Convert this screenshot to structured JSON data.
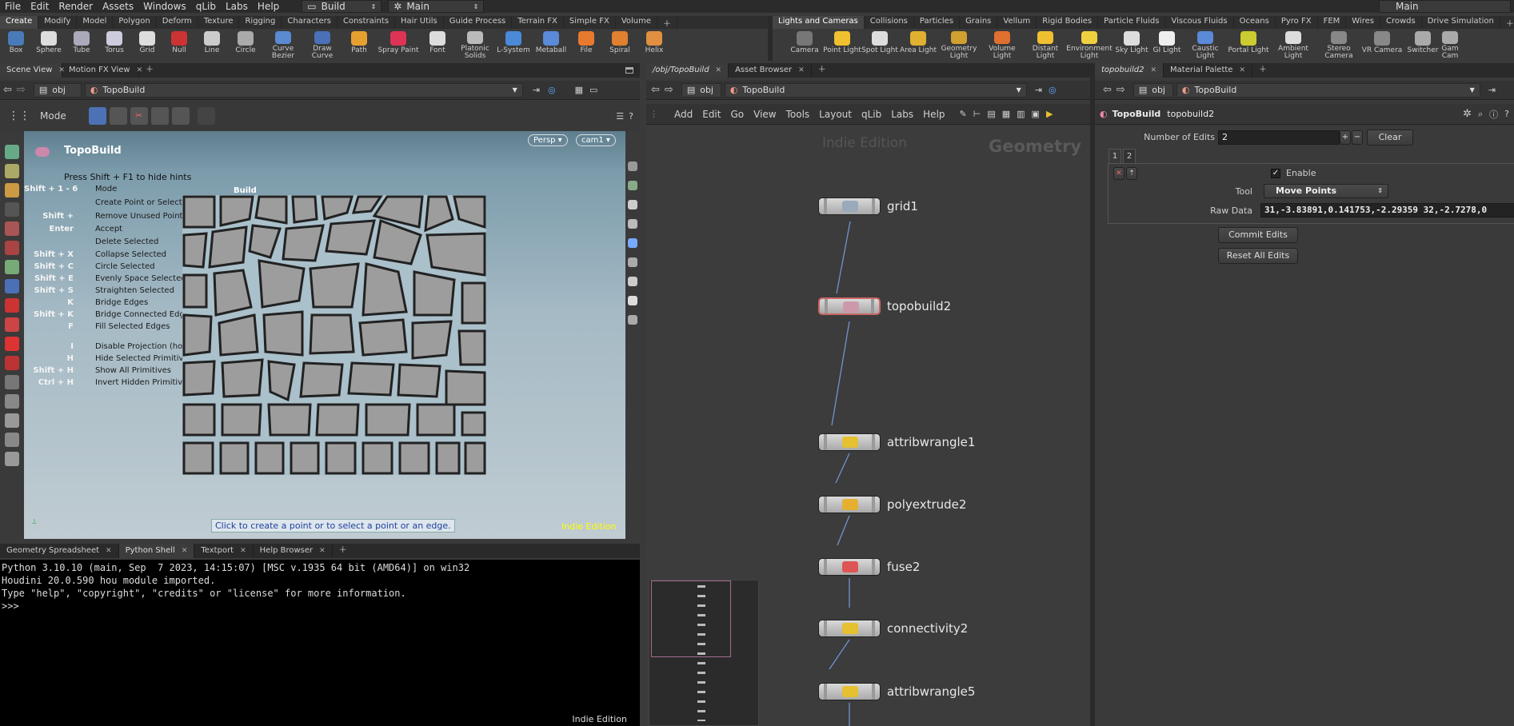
{
  "menubar": {
    "items": [
      "File",
      "Edit",
      "Render",
      "Assets",
      "Windows",
      "qLib",
      "Labs",
      "Help"
    ],
    "desktop": "Build",
    "context": "Main",
    "context_right": "Main"
  },
  "shelf_left": {
    "tabs": [
      "Create",
      "Modify",
      "Model",
      "Polygon",
      "Deform",
      "Texture",
      "Rigging",
      "Characters",
      "Constraints",
      "Hair Utils",
      "Guide Process",
      "Terrain FX",
      "Simple FX",
      "Volume"
    ],
    "tools": [
      "Box",
      "Sphere",
      "Tube",
      "Torus",
      "Grid",
      "Null",
      "Line",
      "Circle",
      "Curve Bezier",
      "Draw Curve",
      "Path",
      "Spray Paint",
      "Font",
      "Platonic Solids",
      "L-System",
      "Metaball",
      "File",
      "Spiral",
      "Helix"
    ],
    "colors": {
      "Box": "#4a7ab8",
      "Sphere": "#ddd",
      "Tube": "#aab",
      "Torus": "#ccd",
      "Grid": "#ddd",
      "Null": "#c33",
      "Line": "#ccc",
      "Circle": "#aaa",
      "Curve Bezier": "#5a8ad0",
      "Draw Curve": "#4a70b8",
      "Path": "#e6a030",
      "Spray Paint": "#d35",
      "Font": "#ddd",
      "Platonic Solids": "#bbb",
      "L-System": "#4a8ad8",
      "Metaball": "#5a8ad8",
      "File": "#e87a30",
      "Spiral": "#e08030",
      "Helix": "#e09040"
    }
  },
  "shelf_right": {
    "tabs": [
      "Lights and Cameras",
      "Collisions",
      "Particles",
      "Grains",
      "Vellum",
      "Rigid Bodies",
      "Particle Fluids",
      "Viscous Fluids",
      "Oceans",
      "Pyro FX",
      "FEM",
      "Wires",
      "Crowds",
      "Drive Simulation"
    ],
    "tools": [
      "Camera",
      "Point Light",
      "Spot Light",
      "Area Light",
      "Geometry Light",
      "Volume Light",
      "Distant Light",
      "Environment Light",
      "Sky Light",
      "GI Light",
      "Caustic Light",
      "Portal Light",
      "Ambient Light",
      "Stereo Camera",
      "VR Camera",
      "Switcher",
      "Gam Cam"
    ],
    "colors": {
      "Camera": "#777",
      "Point Light": "#f0c030",
      "Spot Light": "#ddd",
      "Area Light": "#e0b030",
      "Geometry Light": "#d0a030",
      "Volume Light": "#e07030",
      "Distant Light": "#f0c030",
      "Environment Light": "#f0d040",
      "Sky Light": "#ddd",
      "GI Light": "#eee",
      "Caustic Light": "#5a8ad8",
      "Portal Light": "#cccc30",
      "Ambient Light": "#ddd",
      "Stereo Camera": "#888",
      "VR Camera": "#888",
      "Switcher": "#aaa",
      "Gam Cam": "#aaa"
    }
  },
  "scene_view": {
    "tabs": [
      "Scene View",
      "Motion FX View"
    ],
    "path_root": "obj",
    "path_node": "TopoBuild",
    "mode_label": "Mode",
    "title": "TopoBuild",
    "persp": "Persp",
    "cam": "cam1",
    "hide_hint": "Press Shift + F1 to hide hints",
    "build_label": "Build",
    "hints": [
      {
        "key": "Shift + 1 - 6",
        "text": "Mode"
      },
      {
        "key": "",
        "text": "Create Point or Select Point or Edge"
      },
      {
        "key": "Shift +",
        "text": "Remove Unused Points"
      },
      {
        "key": "Enter",
        "text": "Accept"
      },
      {
        "key": "",
        "text": "Delete Selected"
      },
      {
        "key": "Shift + X",
        "text": "Collapse Selected"
      },
      {
        "key": "Shift + C",
        "text": "Circle Selected"
      },
      {
        "key": "Shift + E",
        "text": "Evenly Space Selected"
      },
      {
        "key": "Shift + S",
        "text": "Straighten Selected"
      },
      {
        "key": "K",
        "text": "Bridge Edges"
      },
      {
        "key": "Shift + K",
        "text": "Bridge Connected Edges"
      },
      {
        "key": "F",
        "text": "Fill Selected Edges"
      },
      {
        "key": "I",
        "text": "Disable Projection (hold)"
      },
      {
        "key": "H",
        "text": "Hide Selected Primitives"
      },
      {
        "key": "Shift + H",
        "text": "Show All Primitives"
      },
      {
        "key": "Ctrl + H",
        "text": "Invert Hidden Primitives"
      }
    ],
    "status": "Click to create a point or to select a point or an edge.",
    "edition": "Indie Edition"
  },
  "bottom_pane": {
    "tabs": [
      "Geometry Spreadsheet",
      "Python Shell",
      "Textport",
      "Help Browser"
    ],
    "console": [
      "Python 3.10.10 (main, Sep  7 2023, 14:15:07) [MSC v.1935 64 bit (AMD64)] on win32",
      "Houdini 20.0.590 hou module imported.",
      "Type \"help\", \"copyright\", \"credits\" or \"license\" for more information.",
      ">>>"
    ],
    "edition": "Indie Edition"
  },
  "network": {
    "tabs": [
      "/obj/TopoBuild",
      "Asset Browser"
    ],
    "path_root": "obj",
    "path_node": "TopoBuild",
    "menu": [
      "Add",
      "Edit",
      "Go",
      "View",
      "Tools",
      "Layout",
      "qLib",
      "Labs",
      "Help"
    ],
    "watermark_left": "Indie Edition",
    "watermark_right": "Geometry",
    "nodes": [
      "grid1",
      "topobuild2",
      "attribwrangle1",
      "polyextrude2",
      "fuse2",
      "connectivity2",
      "attribwrangle5"
    ]
  },
  "params": {
    "tabs": [
      "topobuild2",
      "Material Palette"
    ],
    "path_root": "obj",
    "path_node": "TopoBuild",
    "node_type": "TopoBuild",
    "node_name": "topobuild2",
    "num_edits_label": "Number of Edits",
    "num_edits_value": "2",
    "clear_label": "Clear",
    "sub_tabs": [
      "1",
      "2"
    ],
    "enable_label": "Enable",
    "tool_label": "Tool",
    "tool_value": "Move Points",
    "raw_label": "Raw Data",
    "raw_value": "31,-3.83891,0.141753,-2.29359 32,-2.7278,0",
    "commit_label": "Commit Edits",
    "reset_label": "Reset All Edits"
  }
}
